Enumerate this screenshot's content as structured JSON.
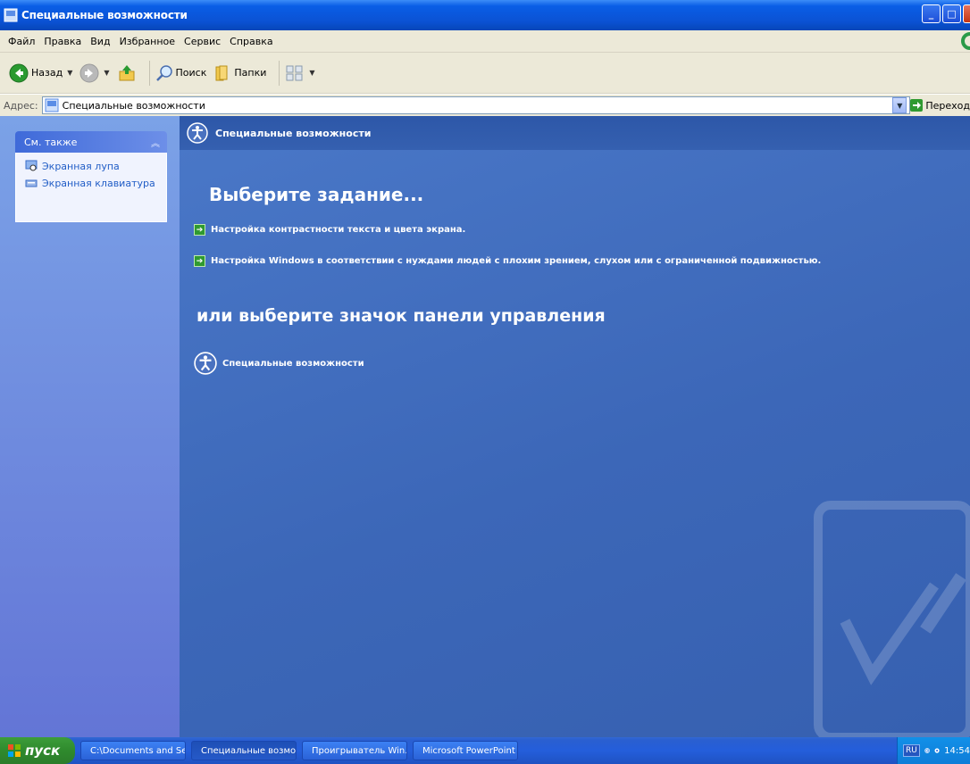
{
  "window": {
    "title": "Специальные возможности",
    "controls": {
      "minimize": "_",
      "maximize": "□",
      "close": "X"
    }
  },
  "menu": [
    "Файл",
    "Правка",
    "Вид",
    "Избранное",
    "Сервис",
    "Справка"
  ],
  "toolbar": {
    "back_label": "Назад",
    "search_label": "Поиск",
    "folders_label": "Папки"
  },
  "address": {
    "label": "Адрес:",
    "value": "Специальные возможности",
    "go_label": "Переход"
  },
  "sidebar": {
    "panel_title": "См. также",
    "links": [
      "Экранная лупа",
      "Экранная клавиатура"
    ]
  },
  "main": {
    "header": "Специальные возможности",
    "choose_task": "Выберите задание...",
    "tasks": [
      "Настройка контрастности текста и цвета экрана.",
      "Настройка Windows в соответствии с нуждами людей с плохим зрением, слухом или с ограниченной подвижностью."
    ],
    "or_choose_icon": "или выберите значок панели управления",
    "cp_item": "Специальные возможности"
  },
  "taskbar": {
    "start_label": "пуск",
    "buttons": [
      "C:\\Documents and Se...",
      "Специальные возмо...",
      "Проигрыватель Win...",
      "Microsoft PowerPoint ..."
    ],
    "language": "RU",
    "clock": "14:54"
  },
  "colors": {
    "title_bar": "#0b52d4",
    "main_pane": "#3c67b8",
    "side_pane": "#6f8ce0",
    "task_green": "#2f9a30",
    "taskbar": "#245edb"
  }
}
